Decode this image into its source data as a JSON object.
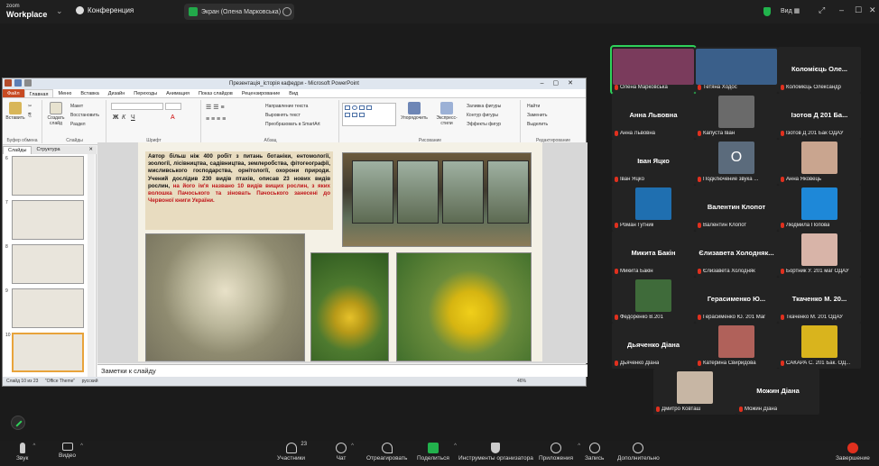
{
  "zoom": {
    "logo_line1": "zoom",
    "logo_line2": "Workplace",
    "meeting_title": "Конференция",
    "screen_share_label": "Экран (Олена Марковська)",
    "view_label": "Вид",
    "colors": {
      "accent_green": "#22b14c",
      "end_red": "#e0301e",
      "muted_red": "#e0301e"
    }
  },
  "ppt": {
    "window_title": "Презентація_історія кафедри - Microsoft PowerPoint",
    "tabs": [
      "Файл",
      "Главная",
      "Меню",
      "Вставка",
      "Дизайн",
      "Переходы",
      "Анимация",
      "Показ слайдов",
      "Рецензирование",
      "Вид"
    ],
    "ribbon": {
      "paste": "Вставить",
      "new_slide": "Создать слайд",
      "layout": "Макет",
      "reset": "Восстановить",
      "section": "Раздел",
      "group_clipboard": "Буфер обмена",
      "group_slides": "Слайды",
      "group_font": "Шрифт",
      "group_paragraph": "Абзац",
      "group_drawing": "Рисование",
      "group_editing": "Редактирование",
      "text_dir": "Направление текста",
      "align_text": "Выровнять текст",
      "smartart": "Преобразовать в SmartArt",
      "arrange": "Упорядочить",
      "quick_styles": "Экспресс-стили",
      "fill": "Заливка фигуры",
      "outline": "Контур фигуры",
      "effects": "Эффекты фигур",
      "find": "Найти",
      "replace": "Заменить",
      "select": "Выделить"
    },
    "panel_tab_slides": "Слайды",
    "panel_tab_outline": "Структура",
    "slide_numbers": [
      "6",
      "7",
      "8",
      "9",
      "10",
      "11"
    ],
    "slide": {
      "text_part1": "Автор більш ніж 400 робіт з питань ботаніки, ентомології, зоології, лісівництва, садівництва, землеробства, фітогеографії, мисливського господарства, орнітології, охорони природи. Учений дослідив 230 видів птахів, описав 23 нових видів рослин, ",
      "text_part2": "на його ім'я названо 10 видів вищих рослин, з яких волошка Пачоського та зіновать Пачоського занесені до Червоної книги України."
    },
    "notes_placeholder": "Заметки к слайду",
    "status": {
      "slide_counter": "Слайд 10 из 23",
      "theme": "\"Office Theme\"",
      "language": "русский",
      "zoom": "46%"
    }
  },
  "participants": [
    {
      "display": "",
      "label": "Олена Марковська",
      "kind": "video",
      "color": "#7a3b5c",
      "active": true
    },
    {
      "display": "",
      "label": "Тетяна Ходос",
      "kind": "video",
      "color": "#3a5f8a",
      "active": false
    },
    {
      "display": "Коломієць Оле...",
      "label": "Коломієць Олександр",
      "kind": "name",
      "color": "",
      "active": false
    },
    {
      "display": "Анна Львовна",
      "label": "Анна Львовна",
      "kind": "name",
      "color": "",
      "active": false
    },
    {
      "display": "",
      "label": "Капуста Іван",
      "kind": "avatar",
      "color": "#6a6a6a",
      "active": false
    },
    {
      "display": "Ізотов Д 201 Ба...",
      "label": "Ізотов Д 201 Бак ОДАУ",
      "kind": "name",
      "color": "",
      "active": false
    },
    {
      "display": "Іван Яцко",
      "label": "Іван Яцко",
      "kind": "name",
      "color": "",
      "active": false
    },
    {
      "display": "",
      "label": "Подключение звука ...",
      "kind": "letter",
      "letter": "O",
      "color": "#5b6b7c",
      "active": false
    },
    {
      "display": "",
      "label": "Анна Яковець",
      "kind": "avatar",
      "color": "#c9a58f",
      "active": false
    },
    {
      "display": "",
      "label": "Роман Гутник",
      "kind": "avatar",
      "color": "#1f6fb0",
      "active": false
    },
    {
      "display": "Валентин Клопот",
      "label": "Валентин Клопот",
      "kind": "name",
      "color": "",
      "active": false
    },
    {
      "display": "",
      "label": "Людмила Попова",
      "kind": "avatar",
      "color": "#1e88d8",
      "active": false
    },
    {
      "display": "Микита Бакін",
      "label": "Микита Бакін",
      "kind": "name",
      "color": "",
      "active": false
    },
    {
      "display": "Єлизавета Холодняк...",
      "label": "Єлизавета Холодняк",
      "kind": "name",
      "color": "",
      "active": false
    },
    {
      "display": "",
      "label": "Бортник У. 201 маг ОДАУ",
      "kind": "avatar",
      "color": "#d8b4a8",
      "active": false
    },
    {
      "display": "",
      "label": "Федоренко В.201",
      "kind": "avatar",
      "color": "#3f6b3a",
      "active": false
    },
    {
      "display": "Герасименко Ю...",
      "label": "Герасименко Ю. 201 Маг",
      "kind": "name",
      "color": "",
      "active": false
    },
    {
      "display": "Ткаченко М. 20...",
      "label": "Ткаченко М. 201 ОДАУ",
      "kind": "name",
      "color": "",
      "active": false
    },
    {
      "display": "Дьяченко Діана",
      "label": "Дьяченко Діана",
      "kind": "name",
      "color": "",
      "active": false
    },
    {
      "display": "",
      "label": "Катерина Свиридова",
      "kind": "avatar",
      "color": "#b0615a",
      "active": false
    },
    {
      "display": "",
      "label": "САКАРА С. 201 Бак. ОД...",
      "kind": "avatar",
      "color": "#d9b41d",
      "active": false
    },
    {
      "display": "",
      "label": "Дмитро Ковташ",
      "kind": "avatar",
      "color": "#c7b6a4",
      "active": false
    },
    {
      "display": "Можин Діана",
      "label": "Можин Діана",
      "kind": "name",
      "color": "",
      "active": false
    }
  ],
  "toolbar": {
    "audio": "Звук",
    "video": "Видео",
    "participants": "Участники",
    "participants_count": "23",
    "chat": "Чат",
    "react": "Отреагировать",
    "share": "Поделиться",
    "host_tools": "Инструменты организатора",
    "apps": "Приложения",
    "record": "Запись",
    "more": "Дополнительно",
    "end": "Завершение"
  }
}
